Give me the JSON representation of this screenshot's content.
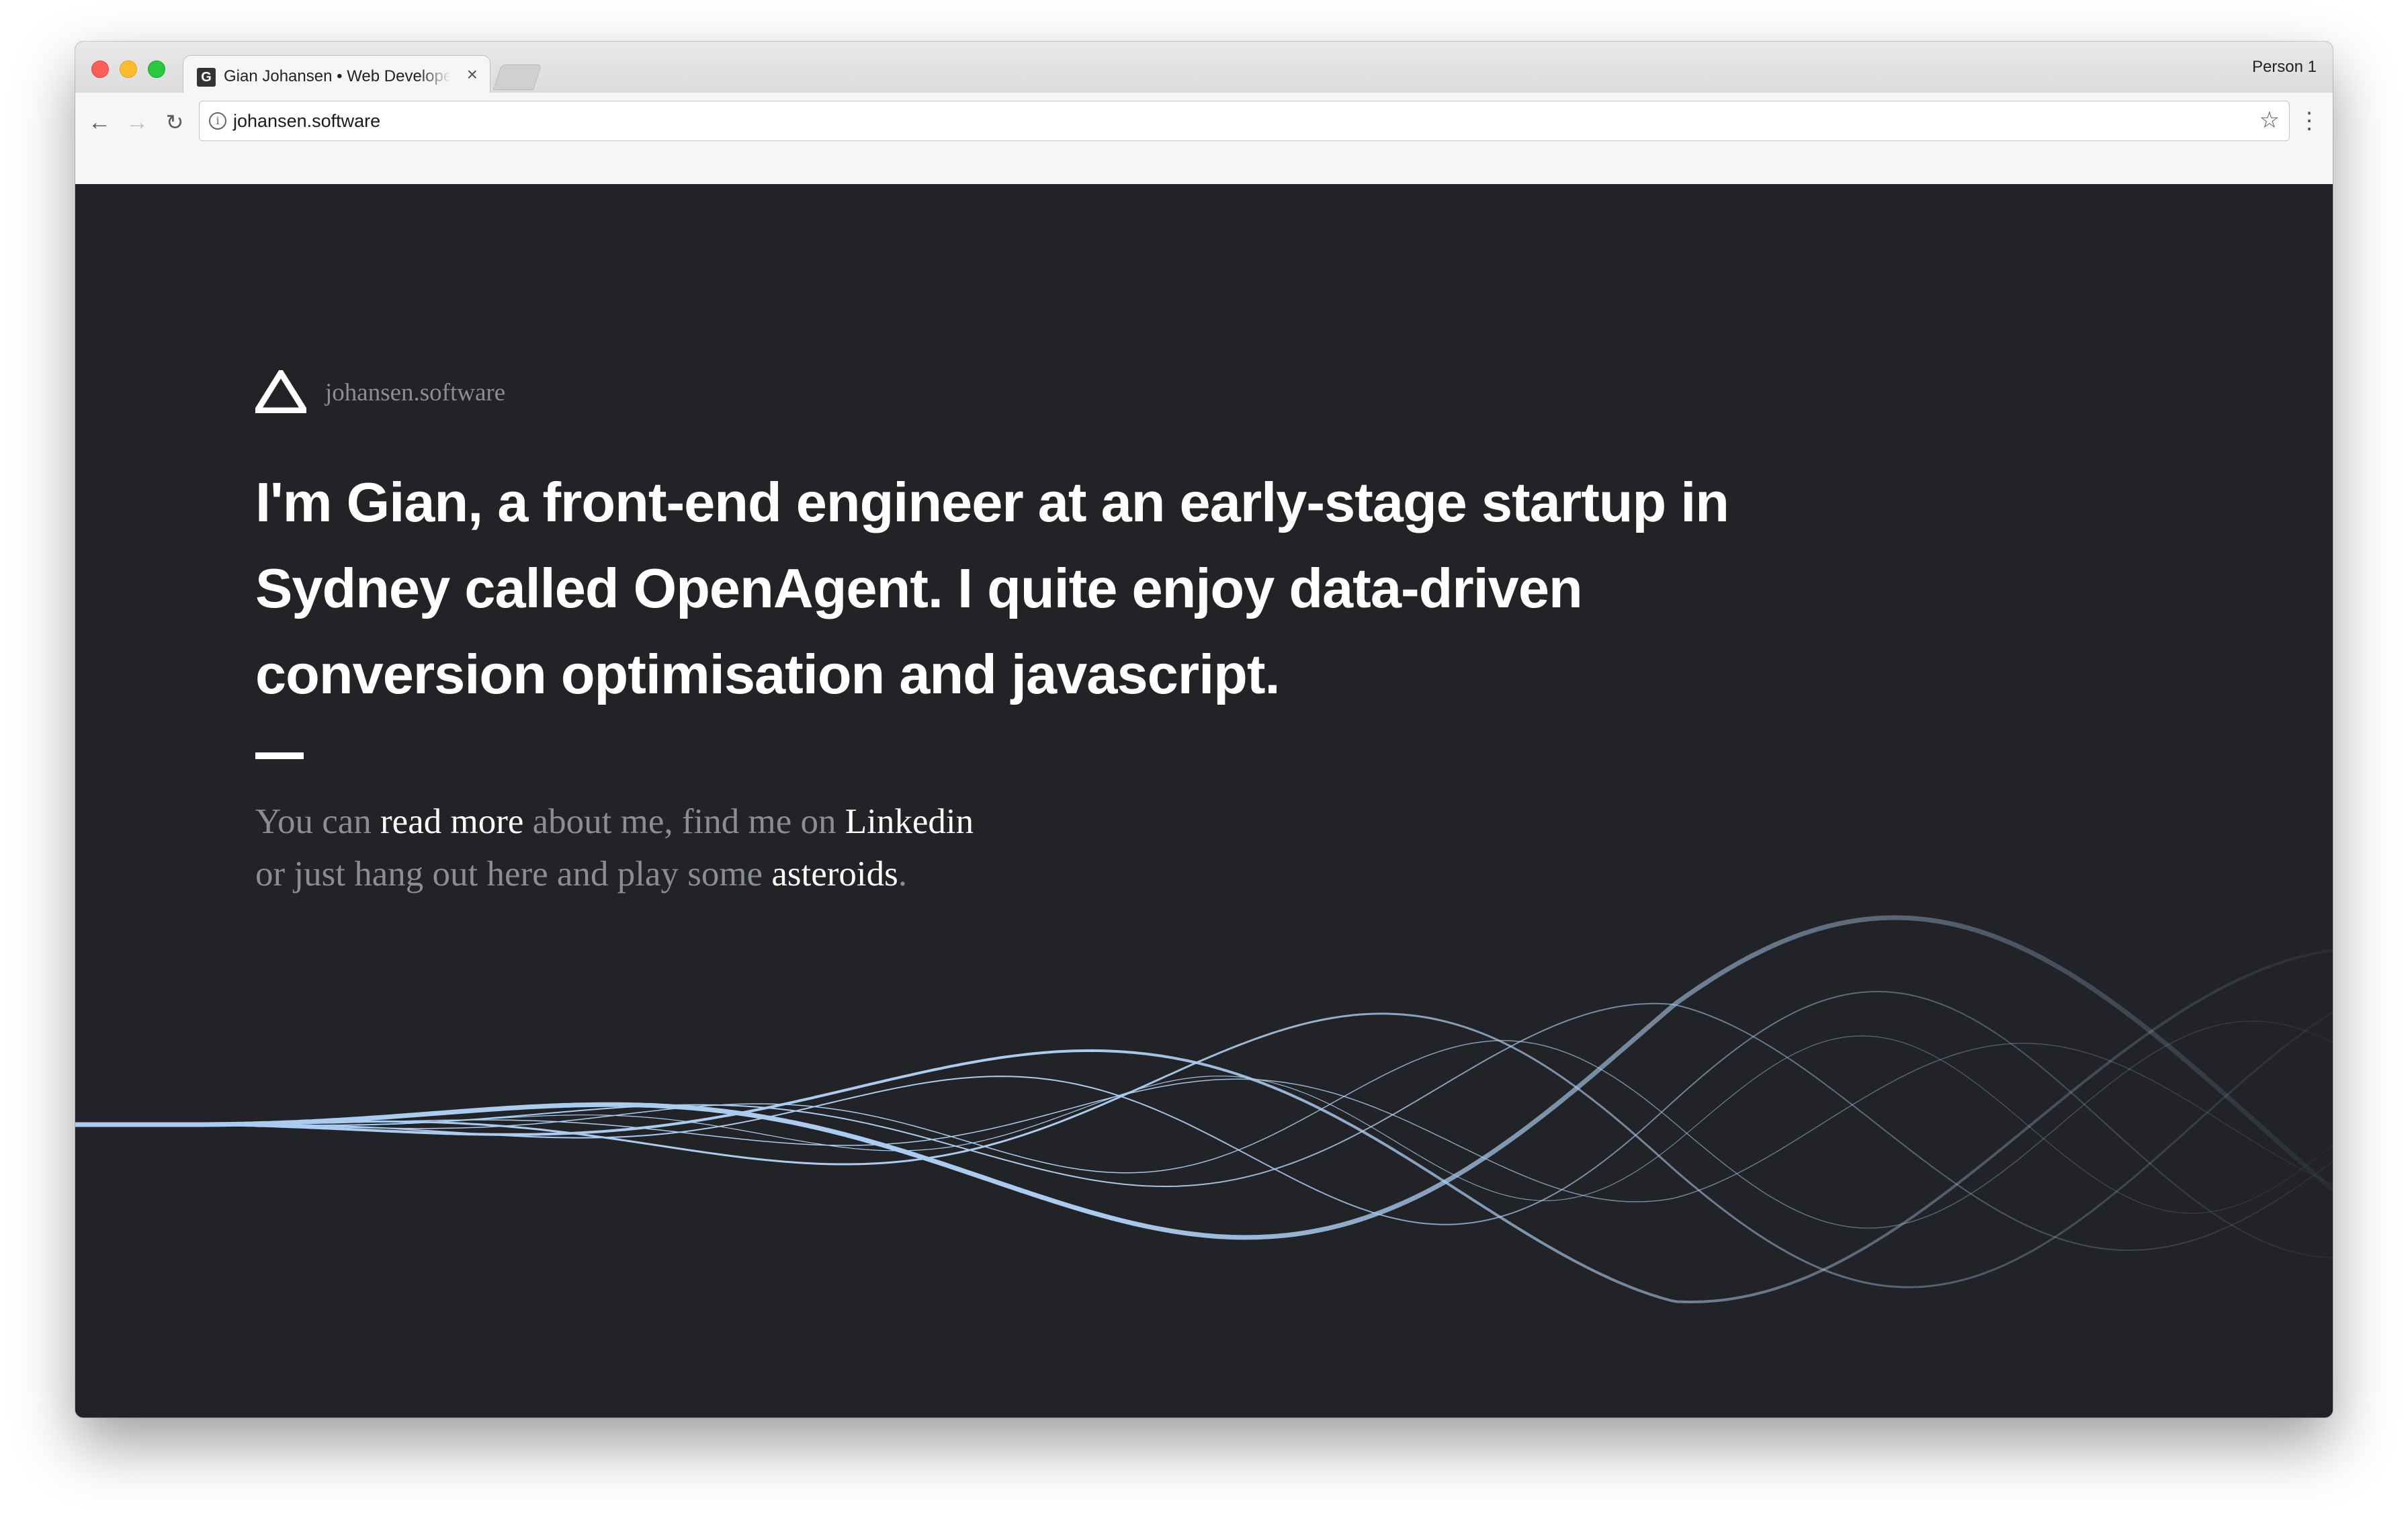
{
  "browser": {
    "tab_title": "Gian Johansen • Web Developer",
    "favicon_letter": "G",
    "tab_close": "×",
    "profile": "Person 1",
    "url": "johansen.software",
    "info_glyph": "i",
    "icons": [
      "back-arrow-icon",
      "forward-arrow-icon",
      "reload-icon",
      "info-icon",
      "star-icon",
      "menu-dots-icon",
      "close-icon"
    ]
  },
  "site": {
    "brand_name": "johansen.software",
    "headline": "I'm Gian, a front-end engineer at an early-stage startup in Sydney called OpenAgent. I quite enjoy data-driven conversion optimisation and javascript.",
    "intro": {
      "t1": "You can ",
      "link_read_more": "read more",
      "t2": " about me, find me on ",
      "link_linkedin": "Linkedin",
      "t3": "or just hang out here and play some ",
      "link_asteroids": "asteroids",
      "t4": "."
    }
  },
  "colors": {
    "page_bg": "#222327",
    "headline": "#ffffff",
    "muted_text": "#8a8d93",
    "link": "#ffffff",
    "wave": "#a9ccf0"
  }
}
